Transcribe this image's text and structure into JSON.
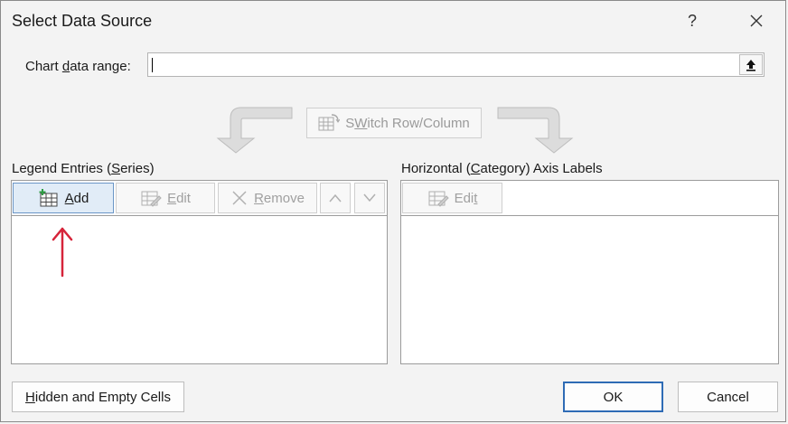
{
  "dialog": {
    "title": "Select Data Source",
    "help_label": "?",
    "close_label": "✕"
  },
  "range": {
    "label_pre": "Chart ",
    "label_u": "d",
    "label_post": "ata range:",
    "value": ""
  },
  "switch": {
    "label_u": "W",
    "label_pre": "S",
    "label_post": "itch Row/Column"
  },
  "legend": {
    "label_pre": "Legend Entries (",
    "label_u": "S",
    "label_post": "eries)",
    "add_u": "A",
    "add_post": "dd",
    "edit_u": "E",
    "edit_post": "dit",
    "remove_u": "R",
    "remove_post": "emove"
  },
  "axis": {
    "label_pre": "Horizontal (",
    "label_u": "C",
    "label_post": "ategory) Axis Labels",
    "edit_pre": "Edi",
    "edit_u": "t"
  },
  "footer": {
    "hidden_u": "H",
    "hidden_post": "idden and Empty Cells",
    "ok_label": "OK",
    "cancel_label": "Cancel"
  },
  "colors": {
    "accent": "#2e6bb5",
    "annotation_arrow": "#d6243a",
    "add_icon_plus": "#2f9e44"
  },
  "icons": [
    "help-icon",
    "close-icon",
    "collapse-dialog-icon",
    "switch-row-column-icon",
    "table-add-icon",
    "table-edit-icon",
    "remove-x-icon",
    "chevron-up-icon",
    "chevron-down-icon"
  ]
}
